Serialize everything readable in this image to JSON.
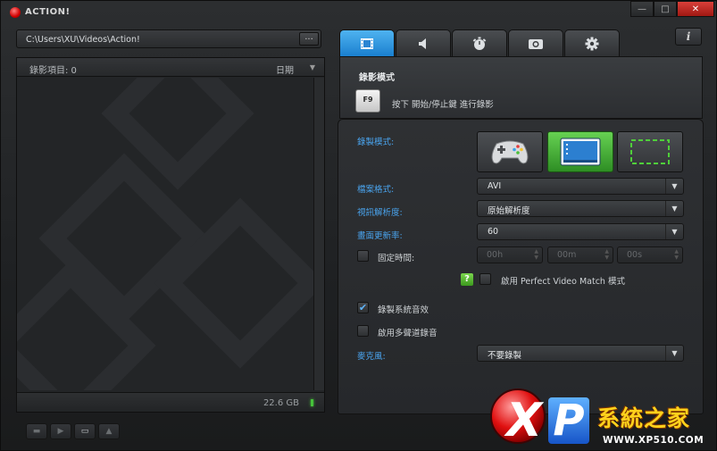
{
  "app": {
    "title": "ACTION!",
    "window_buttons": [
      "—",
      "□",
      "✕"
    ]
  },
  "left": {
    "path": "C:\\Users\\XU\\Videos\\Action!",
    "browse_label": "...",
    "list_count": "錄影項目: 0",
    "sort_label": "日期",
    "disk_free": "22.6 GB"
  },
  "tabs": [
    {
      "icon": "film-icon",
      "active": true
    },
    {
      "icon": "speaker-icon",
      "active": false
    },
    {
      "icon": "stopwatch-icon",
      "active": false
    },
    {
      "icon": "camera-icon",
      "active": false
    },
    {
      "icon": "gear-icon",
      "active": false
    }
  ],
  "info_label": "i",
  "record": {
    "section_title": "錄影模式",
    "hotkey": "F9",
    "hotkey_hint": "按下 開始/停止鍵 進行錄影",
    "mode_label": "錄製模式:",
    "format_label": "檔案格式:",
    "format_value": "AVI",
    "resolution_label": "視訊解析度:",
    "resolution_value": "原始解析度",
    "fps_label": "畫面更新率:",
    "fps_value": "60",
    "fixed_time_label": "固定時間:",
    "hours": "00h",
    "minutes": "00m",
    "seconds": "00s",
    "help_label": "?",
    "perfect_match_label": "啟用 Perfect Video Match 模式",
    "system_audio_label": "錄製系統音效",
    "system_audio_checked": true,
    "multitrack_label": "啟用多聲道錄音",
    "multitrack_checked": false,
    "mic_label": "麥克風:",
    "mic_value": "不要錄製"
  },
  "watermark": {
    "letters": "XP",
    "name": "系統之家",
    "url": "WWW.XP510.COM"
  },
  "colors": {
    "accent_blue": "#4aa4ee",
    "active_tab": "#1a7fcf",
    "active_mode": "#3ea82f"
  }
}
